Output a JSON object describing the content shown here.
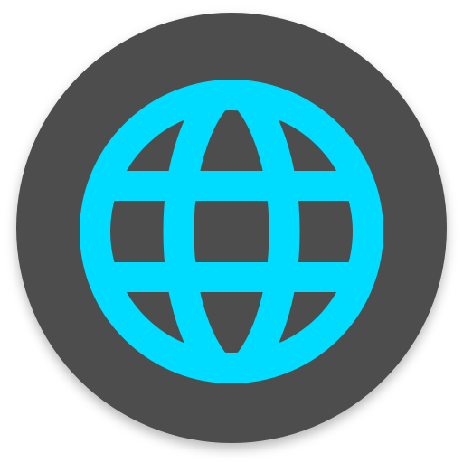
{
  "icon": {
    "name": "globe-icon",
    "colors": {
      "background": "#ffffff",
      "badge": "#4d4d4d",
      "badge_shadow": "#3a3a3a",
      "glyph": "#00dcff"
    }
  }
}
